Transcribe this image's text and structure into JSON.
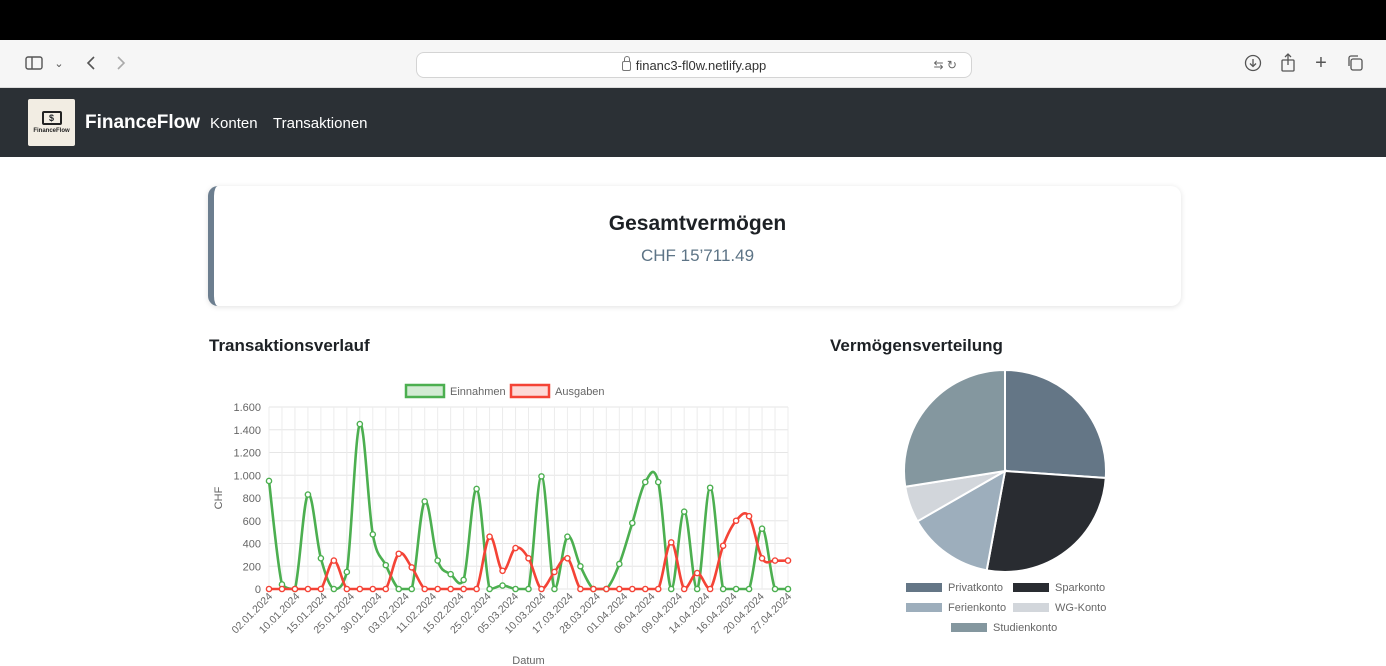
{
  "browser": {
    "url": "financ3-fl0w.netlify.app"
  },
  "nav": {
    "brand": "FinanceFlow",
    "logo_text": "FinanceFlow",
    "links": [
      "Konten",
      "Transaktionen"
    ]
  },
  "summary": {
    "title": "Gesamtvermögen",
    "value": "CHF 15’711.49"
  },
  "line_chart_title": "Transaktionsverlauf",
  "pie_chart_title": "Vermögensverteilung",
  "chart_data": [
    {
      "type": "line",
      "title": "",
      "xlabel": "Datum",
      "ylabel": "CHF",
      "ylim": [
        0,
        1600
      ],
      "yticks": [
        "0",
        "200",
        "400",
        "600",
        "800",
        "1.000",
        "1.200",
        "1.400",
        "1.600"
      ],
      "grid": true,
      "legend": "top",
      "categories": [
        "02.01.2024",
        "10.01.2024",
        "15.01.2024",
        "25.01.2024",
        "30.01.2024",
        "03.02.2024",
        "11.02.2024",
        "15.02.2024",
        "25.02.2024",
        "05.03.2024",
        "10.03.2024",
        "17.03.2024",
        "28.03.2024",
        "01.04.2024",
        "06.04.2024",
        "09.04.2024",
        "14.04.2024",
        "16.04.2024",
        "20.04.2024",
        "27.04.2024"
      ],
      "x": [
        0,
        1,
        2,
        3,
        4,
        5,
        6,
        7,
        8,
        9,
        10,
        11,
        12,
        13,
        14,
        15,
        16,
        17,
        18,
        19,
        20,
        21,
        22,
        23,
        24,
        25,
        26,
        27,
        28,
        29,
        30,
        31,
        32,
        33,
        34,
        35,
        36,
        37,
        38,
        39,
        40
      ],
      "series": [
        {
          "name": "Einnahmen",
          "color": "#4caf50",
          "values": [
            950,
            40,
            0,
            830,
            270,
            0,
            150,
            1450,
            480,
            210,
            0,
            0,
            770,
            250,
            130,
            80,
            880,
            0,
            30,
            0,
            0,
            990,
            0,
            460,
            200,
            0,
            0,
            220,
            580,
            940,
            940,
            0,
            680,
            0,
            890,
            0,
            0,
            0,
            530,
            0,
            0
          ]
        },
        {
          "name": "Ausgaben",
          "color": "#f44336",
          "values": [
            0,
            0,
            0,
            0,
            0,
            250,
            0,
            0,
            0,
            0,
            310,
            190,
            0,
            0,
            0,
            0,
            0,
            460,
            160,
            360,
            270,
            0,
            150,
            270,
            0,
            0,
            0,
            0,
            0,
            0,
            0,
            410,
            0,
            140,
            0,
            380,
            600,
            640,
            270,
            250,
            250
          ]
        }
      ]
    },
    {
      "type": "pie",
      "title": "",
      "legend": "bottom",
      "categories": [
        "Privatkonto",
        "Sparkonto",
        "Ferienkonto",
        "WG-Konto",
        "Studienkonto"
      ],
      "values": [
        26.1,
        26.8,
        13.8,
        5.8,
        27.5
      ],
      "colors": [
        "#647686",
        "#292c31",
        "#9daebc",
        "#d2d6db",
        "#84979f"
      ]
    }
  ]
}
